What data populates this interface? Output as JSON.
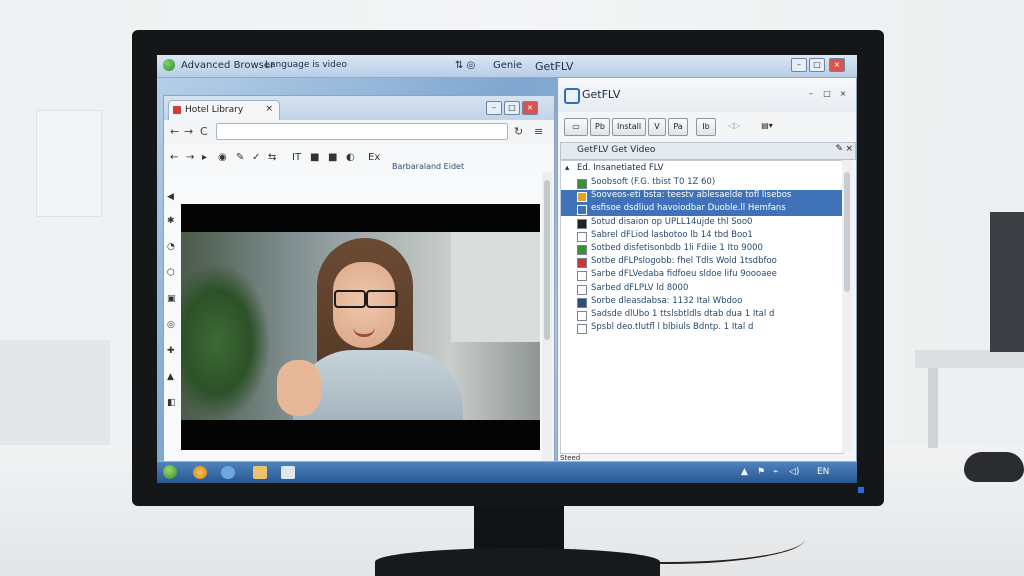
{
  "os": {
    "titlebar_left": "Advanced Browser",
    "titlebar_subtitle": "Language is video",
    "titlebar_right": "GetFLV",
    "titlebar_mid": "Genie",
    "win_controls": [
      "–",
      "□",
      "×"
    ]
  },
  "browser": {
    "tab_title": "Hotel Library",
    "tab_close": "×",
    "nav_back": "←",
    "nav_forward": "→",
    "reload": "C",
    "menu": "≡",
    "refresh": "↻",
    "toolbar_icons": [
      "←",
      "→",
      "▸",
      "◉",
      "✎",
      "✓",
      "⇆",
      "IT",
      "■",
      "■",
      "◐",
      "Ex"
    ],
    "toolbar_caption": "Barbaraland Eidet",
    "side_icons": [
      "◀",
      "✱",
      "◔",
      "⬡",
      "▣",
      "◎",
      "✚",
      "▲",
      "◧"
    ]
  },
  "getflv": {
    "title": "GetFLV",
    "tool_buttons": [
      "▭",
      "Pb",
      "Install",
      "V",
      "Pa",
      "Ib",
      "◁▷",
      "▤▾"
    ],
    "tree_header": "GetFLV  Get Video",
    "tree_root": "Ed. Insanetiated FLV",
    "items": [
      {
        "text": "Soobsoft (F.G. tbist T0 1Z 60)",
        "selected": false,
        "icon_color": "#3b8f3b"
      },
      {
        "text": "Sooveos-eti bsta: teestv ablesaelde tofl lisebos",
        "selected": true,
        "icon_color": "#e4a22c"
      },
      {
        "text": "esfisoe dsdliud havoiodbar Duoble.ll Hemfans",
        "selected": true,
        "icon_color": "#3f72b8"
      },
      {
        "text": "Sotud disaion op UPLL14ujde thl Soo0",
        "selected": false,
        "icon_color": "#222222"
      },
      {
        "text": "Sabrel dFLiod lasbotoo lb 14 tbd Boo1",
        "selected": false,
        "icon_color": "#ffffff"
      },
      {
        "text": "Sotbed disfetisonbdb 1li Fdiie 1 Ito 9000",
        "selected": false,
        "icon_color": "#3b8f3b"
      },
      {
        "text": "Sotbe dFLPslogobb: fhel Tdls Wold 1tsdbfoo",
        "selected": false,
        "icon_color": "#c33a3a"
      },
      {
        "text": "Sarbe dFLVedaba fidfoeu sldoe lifu 9oooaee",
        "selected": false,
        "icon_color": "#ffffff"
      },
      {
        "text": "Sarbed dFLPLV ld 8000",
        "selected": false,
        "icon_color": "#ffffff"
      },
      {
        "text": "Sorbe dleasdabsa: 1132 Ital Wbdoo",
        "selected": false,
        "icon_color": "#2f4f7a"
      },
      {
        "text": "Sadsde dlUbo 1 ttslsbtldls dtab dua 1 Ital d",
        "selected": false,
        "icon_color": "#ffffff"
      },
      {
        "text": "Spsbl deo.tlutfl l blbiuls Bdntp. 1 Ital d",
        "selected": false,
        "icon_color": "#ffffff"
      }
    ],
    "status": "Steed"
  },
  "taskbar": {
    "tray_icons": [
      "▲",
      "⚑",
      "⌁",
      "◁)",
      "EN"
    ]
  },
  "colors": {
    "selection": "#3f72b8",
    "taskbar": "#26558f",
    "titlebar": "#b7cde6"
  }
}
